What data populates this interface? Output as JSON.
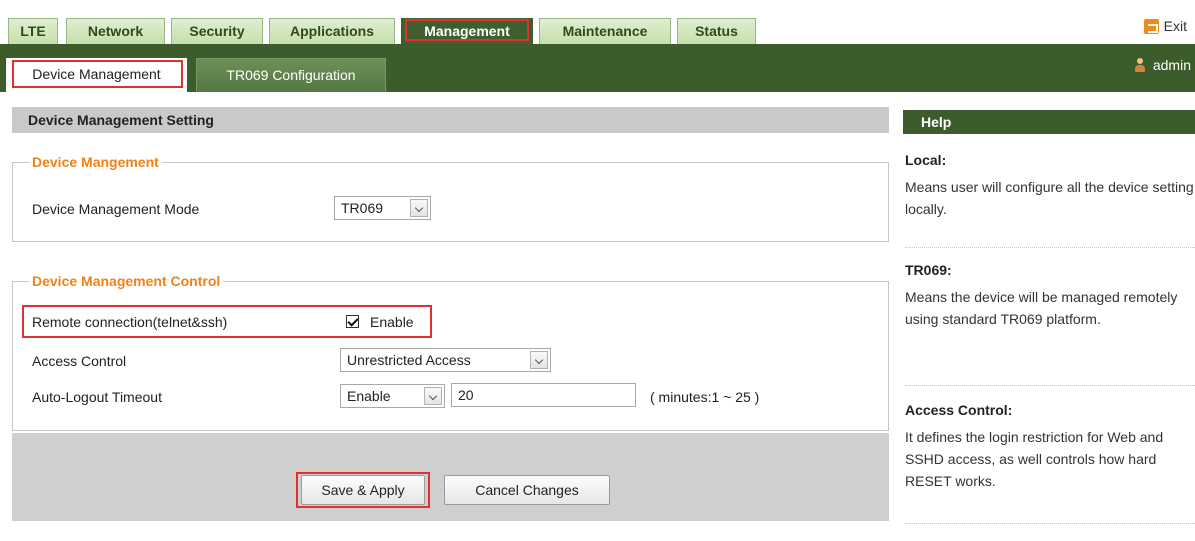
{
  "top_tabs": [
    {
      "label": "LTE"
    },
    {
      "label": "Network"
    },
    {
      "label": "Security"
    },
    {
      "label": "Applications"
    },
    {
      "label": "Management"
    },
    {
      "label": "Maintenance"
    },
    {
      "label": "Status"
    }
  ],
  "header": {
    "exit_label": "Exit",
    "user_label": "admin"
  },
  "sub_tabs": [
    {
      "label": "Device Management"
    },
    {
      "label": "TR069 Configuration"
    }
  ],
  "section": {
    "title": "Device Management Setting"
  },
  "device_management": {
    "legend": "Device Mangement",
    "mode_label": "Device Management Mode",
    "mode_value": "TR069"
  },
  "device_control": {
    "legend": "Device Management Control",
    "remote_label": "Remote connection(telnet&ssh)",
    "remote_checkbox_label": "Enable",
    "access_label": "Access Control",
    "access_value": "Unrestricted Access",
    "logout_label": "Auto-Logout Timeout",
    "logout_mode": "Enable",
    "logout_minutes": "20",
    "logout_hint": "( minutes:1 ~ 25 )"
  },
  "buttons": {
    "save": "Save & Apply",
    "cancel": "Cancel Changes"
  },
  "help": {
    "title": "Help",
    "items": [
      {
        "title": "Local:",
        "text": "Means user will configure all the device setting locally."
      },
      {
        "title": "TR069:",
        "text": "Means the device will be managed remotely using standard TR069 platform."
      },
      {
        "title": "Access Control:",
        "text": "It defines the login restriction for Web and SSHD access, as well controls how hard RESET works."
      }
    ]
  },
  "colors": {
    "brand_green": "#3d5c2c",
    "accent_orange": "#f08218",
    "highlight_red": "#e03030"
  }
}
